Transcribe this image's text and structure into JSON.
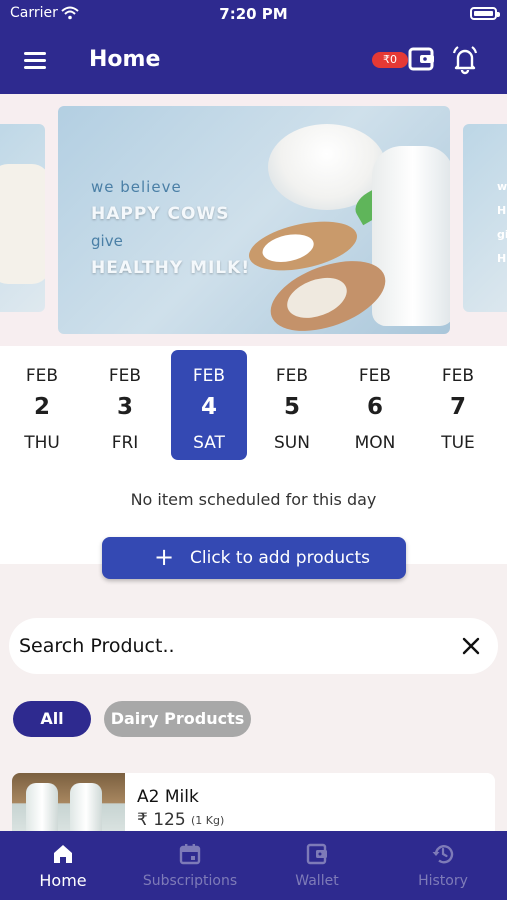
{
  "status_bar": {
    "carrier": "Carrier",
    "time": "7:20 PM"
  },
  "header": {
    "title": "Home",
    "wallet_balance": "₹0"
  },
  "banner": {
    "line1": "we believe",
    "line2": "HAPPY COWS",
    "line3": "give",
    "line4": "HEALTHY MILK!",
    "peek_right": [
      "we",
      "H",
      "gi",
      "H"
    ]
  },
  "dates": [
    {
      "month": "FEB",
      "day": "2",
      "weekday": "THU",
      "selected": false
    },
    {
      "month": "FEB",
      "day": "3",
      "weekday": "FRI",
      "selected": false
    },
    {
      "month": "FEB",
      "day": "4",
      "weekday": "SAT",
      "selected": true
    },
    {
      "month": "FEB",
      "day": "5",
      "weekday": "SUN",
      "selected": false
    },
    {
      "month": "FEB",
      "day": "6",
      "weekday": "MON",
      "selected": false
    },
    {
      "month": "FEB",
      "day": "7",
      "weekday": "TUE",
      "selected": false
    }
  ],
  "schedule": {
    "empty_message": "No item scheduled for this day",
    "add_button_label": "Click to add products"
  },
  "search": {
    "placeholder": "Search Product.."
  },
  "categories": [
    {
      "label": "All",
      "active": true
    },
    {
      "label": "Dairy Products",
      "active": false
    }
  ],
  "products": [
    {
      "name": "A2 Milk",
      "price": "₹ 125",
      "unit": "(1 Kg)"
    }
  ],
  "bottom_nav": [
    {
      "label": "Home",
      "icon": "home-icon",
      "active": true
    },
    {
      "label": "Subscriptions",
      "icon": "calendar-icon",
      "active": false
    },
    {
      "label": "Wallet",
      "icon": "wallet-icon",
      "active": false
    },
    {
      "label": "History",
      "icon": "history-icon",
      "active": false
    }
  ],
  "colors": {
    "primary": "#2e2a8f",
    "accent_blue": "#3449b3",
    "badge_red": "#e53935",
    "chip_inactive": "#a8a8a8",
    "page_bg": "#f6f0f0"
  }
}
